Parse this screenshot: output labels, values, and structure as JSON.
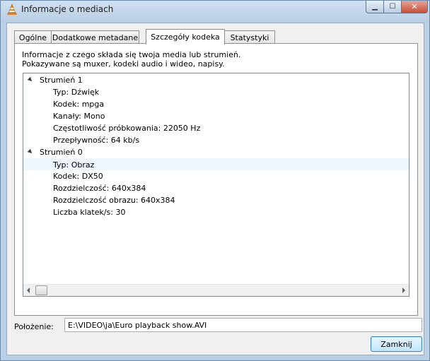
{
  "window": {
    "title": "Informacje o mediach",
    "min_glyph": "▁",
    "max_glyph": "☐",
    "close_glyph": "✕",
    "app_icon": "vlc-cone-icon"
  },
  "tabs": [
    {
      "label": "Ogólne"
    },
    {
      "label": "Dodatkowe metadane"
    },
    {
      "label": "Szczegóły kodeka",
      "active": true
    },
    {
      "label": "Statystyki"
    }
  ],
  "panel": {
    "description_line1": "Informacje z czego składa się twoja media lub strumień.",
    "description_line2": "Pokazywane są muxer, kodeki audio i wideo, napisy."
  },
  "tree": {
    "streams": [
      {
        "label": "Strumień 1",
        "expanded": true,
        "items": [
          "Typ: Dźwięk",
          "Kodek: mpga",
          "Kanały: Mono",
          "Częstotliwość próbkowania: 22050 Hz",
          "Przepływność: 64 kb/s"
        ]
      },
      {
        "label": "Strumień 0",
        "expanded": true,
        "items": [
          "Typ: Obraz",
          "Kodek: DX50",
          "Rozdzielczość: 640x384",
          "Rozdzielczość obrazu: 640x384",
          "Liczba klatek/s: 30"
        ]
      }
    ],
    "highlighted_item": "Typ: Obraz"
  },
  "location": {
    "label": "Położenie:",
    "value": "E:\\VIDEO\\ja\\Euro playback show.AVI"
  },
  "buttons": {
    "close_label": "Zamknij"
  }
}
